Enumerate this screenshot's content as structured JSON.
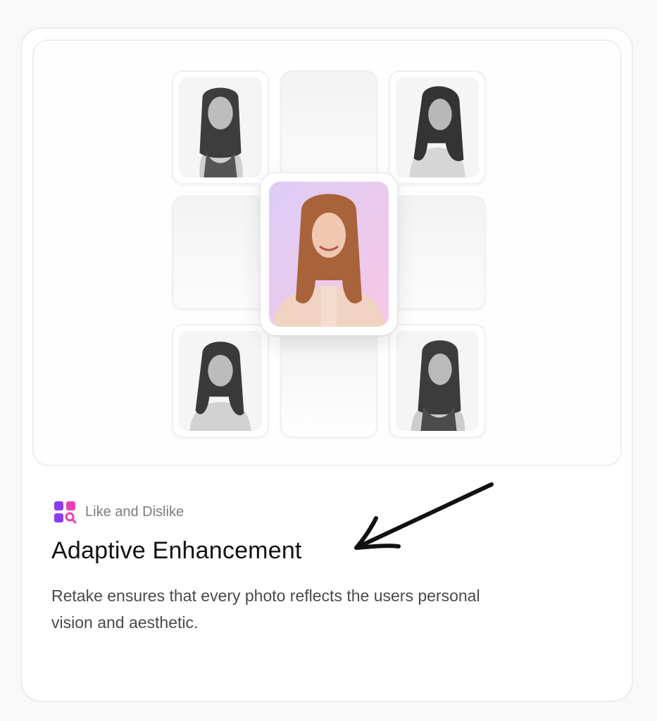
{
  "feature": {
    "tag_label": "Like and Dislike",
    "tag_icon": "app-grid-search-icon",
    "title": "Adaptive Enhancement",
    "description": "Retake ensures that every photo reflects the users personal vision and aesthetic."
  },
  "colors": {
    "accent_purple": "#8b3cf0",
    "accent_pink": "#ec3fb8",
    "center_photo_bg": "#eccbf0"
  },
  "grid": {
    "tiles": [
      {
        "position": "top-left",
        "content": "grayscale-portrait"
      },
      {
        "position": "top-center",
        "content": "empty"
      },
      {
        "position": "top-right",
        "content": "grayscale-portrait"
      },
      {
        "position": "middle-left",
        "content": "empty"
      },
      {
        "position": "middle-center",
        "content": "color-portrait"
      },
      {
        "position": "middle-right",
        "content": "empty"
      },
      {
        "position": "bottom-left",
        "content": "grayscale-portrait"
      },
      {
        "position": "bottom-center",
        "content": "empty"
      },
      {
        "position": "bottom-right",
        "content": "grayscale-portrait"
      }
    ]
  },
  "annotation": {
    "arrow_icon": "hand-drawn-arrow-icon"
  }
}
